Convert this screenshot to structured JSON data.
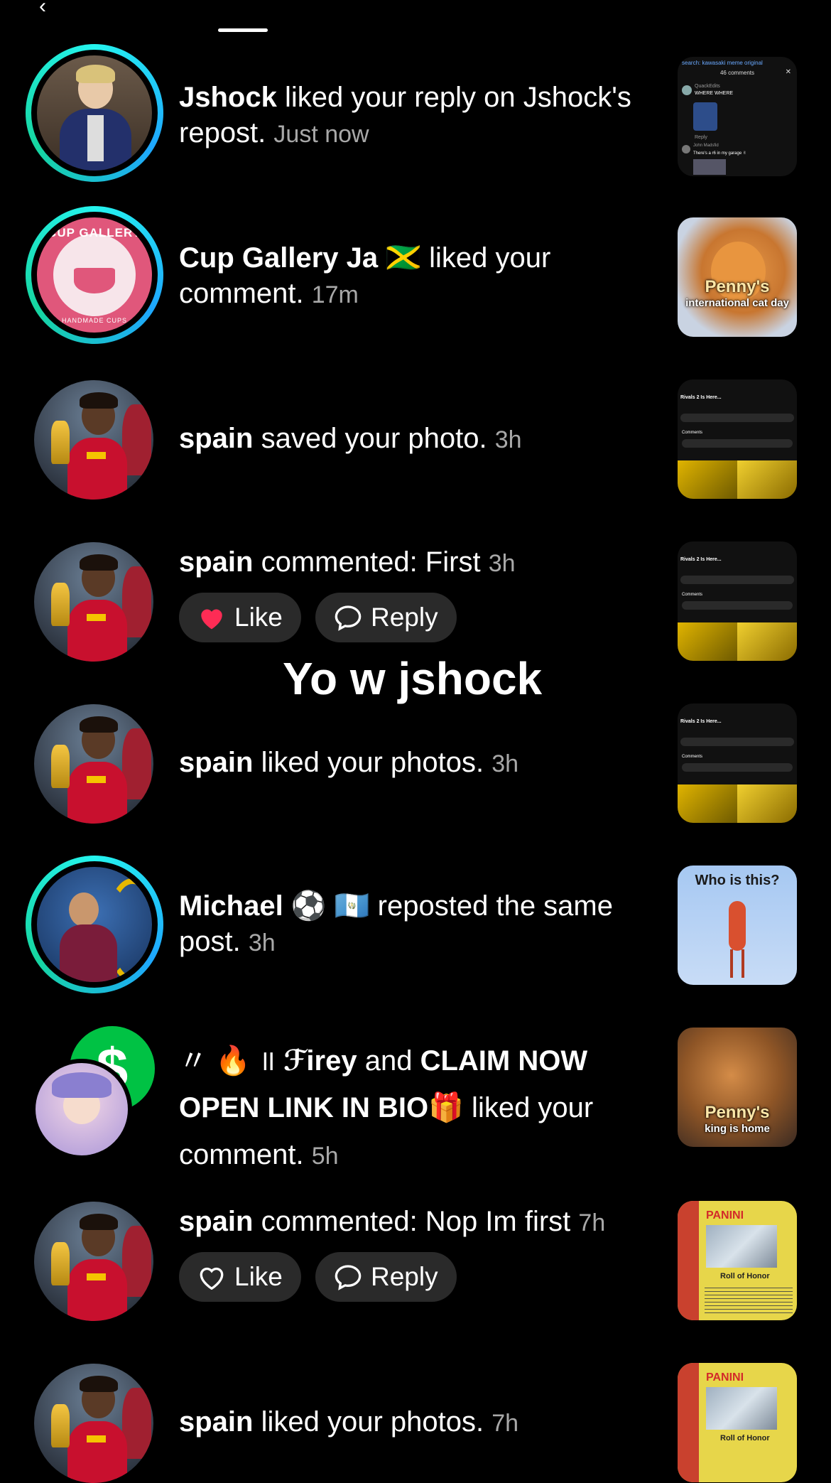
{
  "header": {
    "back_glyph": "‹"
  },
  "overlay_text": "Yo w jshock",
  "notifications": [
    {
      "name": "Jshock",
      "action": " liked your reply on Jshock's repost.",
      "time": "Just now"
    },
    {
      "name": "Cup Gallery Ja 🇯🇲",
      "action": " liked your comment.",
      "time": "17m",
      "avatar_text": "CUP GALLERY",
      "avatar_sub": "HANDMADE CUPS"
    },
    {
      "name": "spain",
      "action": " saved your photo.",
      "time": "3h"
    },
    {
      "name": "spain",
      "action": " commented: First",
      "time": "3h",
      "like_label": "Like",
      "reply_label": "Reply"
    },
    {
      "name": "spain",
      "action": " liked your photos.",
      "time": "3h"
    },
    {
      "name": "Michael ⚽ 🇬🇹",
      "action": " reposted the same post.",
      "time": "3h"
    },
    {
      "prefix": "〃 🔥 ॥ ",
      "name": "ℱirey",
      "mid": " and ",
      "name2": "CLAIM NOW OPEN LINK IN BIO🎁",
      "action": " liked your comment.",
      "time": "5h"
    },
    {
      "name": "spain",
      "action": " commented: Nop Im first",
      "time": "7h",
      "like_label": "Like",
      "reply_label": "Reply"
    },
    {
      "name": "spain",
      "action": " liked your photos.",
      "time": "7h"
    }
  ],
  "thumbs": {
    "t1_search": "search: kawasaki meme original",
    "t1_count": "46 comments",
    "t1_user": "QuackEdits",
    "t1_text": "WHERE WHERE",
    "t1_reply": "Reply",
    "t1_user2": "John Madsfid",
    "t1_text2": "There's a r6 in my garage ✌",
    "t2_title": "Penny's",
    "t2_sub": "international cat day",
    "t3_title": "Rivals 2 Is Here...",
    "t3_comments": "Comments",
    "t6_title": "Who is this?",
    "t7_title": "Penny's",
    "t7_sub": "king is home",
    "t8_brand": "PANINI",
    "t8_roll": "Roll of Honor"
  },
  "colors": {
    "like_red": "#fe2c55",
    "ring_cyan": "#25f4ee",
    "ring_blue": "#1ea7ff",
    "cash_green": "#00c244"
  }
}
